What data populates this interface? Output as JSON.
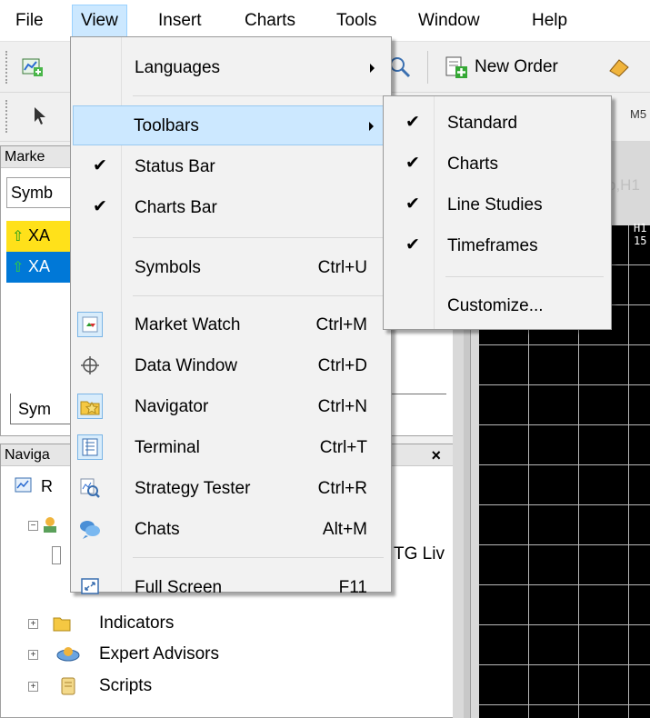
{
  "menubar": {
    "items": [
      "File",
      "View",
      "Insert",
      "Charts",
      "Tools",
      "Window",
      "Help"
    ]
  },
  "toolbar": {
    "new_order_label": "New Order",
    "timeframe_partial": "M5"
  },
  "market_watch": {
    "title_partial": "Marke",
    "column_partial": "Symb",
    "rows": [
      {
        "symbol_partial": "XA",
        "bg": "#ffe11a"
      },
      {
        "symbol_partial": "XA",
        "bg": "#0078d7"
      }
    ],
    "tab_partial": "Sym"
  },
  "navigator": {
    "title_partial": "Naviga",
    "close_label": "×",
    "root_partial": "R",
    "account_partial": "TG Liv",
    "items": [
      "Indicators",
      "Expert Advisors",
      "Scripts"
    ]
  },
  "chart": {
    "tab_partial": "o,H1",
    "header_partial": "H1 15"
  },
  "view_menu": {
    "items": [
      {
        "label": "Languages",
        "shortcut": "",
        "submenu": true,
        "checked": false,
        "icon": ""
      },
      {
        "label": "Toolbars",
        "shortcut": "",
        "submenu": true,
        "checked": false,
        "icon": "",
        "highlighted": true
      },
      {
        "label": "Status Bar",
        "shortcut": "",
        "checked": true,
        "icon": ""
      },
      {
        "label": "Charts Bar",
        "shortcut": "",
        "checked": true,
        "icon": ""
      },
      {
        "label": "Symbols",
        "shortcut": "Ctrl+U",
        "checked": false,
        "icon": ""
      },
      {
        "label": "Market Watch",
        "shortcut": "Ctrl+M",
        "checked": false,
        "icon": "market-watch-icon"
      },
      {
        "label": "Data Window",
        "shortcut": "Ctrl+D",
        "checked": false,
        "icon": "crosshair-icon"
      },
      {
        "label": "Navigator",
        "shortcut": "Ctrl+N",
        "checked": false,
        "icon": "navigator-star-icon"
      },
      {
        "label": "Terminal",
        "shortcut": "Ctrl+T",
        "checked": false,
        "icon": "terminal-icon"
      },
      {
        "label": "Strategy Tester",
        "shortcut": "Ctrl+R",
        "checked": false,
        "icon": "strategy-tester-icon"
      },
      {
        "label": "Chats",
        "shortcut": "Alt+M",
        "checked": false,
        "icon": "chat-bubbles-icon"
      },
      {
        "label": "Full Screen",
        "shortcut": "F11",
        "checked": false,
        "icon": "fullscreen-icon"
      }
    ]
  },
  "toolbars_submenu": {
    "items": [
      {
        "label": "Standard",
        "checked": true
      },
      {
        "label": "Charts",
        "checked": true
      },
      {
        "label": "Line Studies",
        "checked": true
      },
      {
        "label": "Timeframes",
        "checked": true
      },
      {
        "label": "Customize...",
        "checked": false
      }
    ]
  },
  "colors": {
    "highlight": "#cce8ff",
    "highlight_border": "#99c9f0",
    "chart_bg": "#000000",
    "grid": "#b8b8b8"
  },
  "check_glyph": "✔"
}
